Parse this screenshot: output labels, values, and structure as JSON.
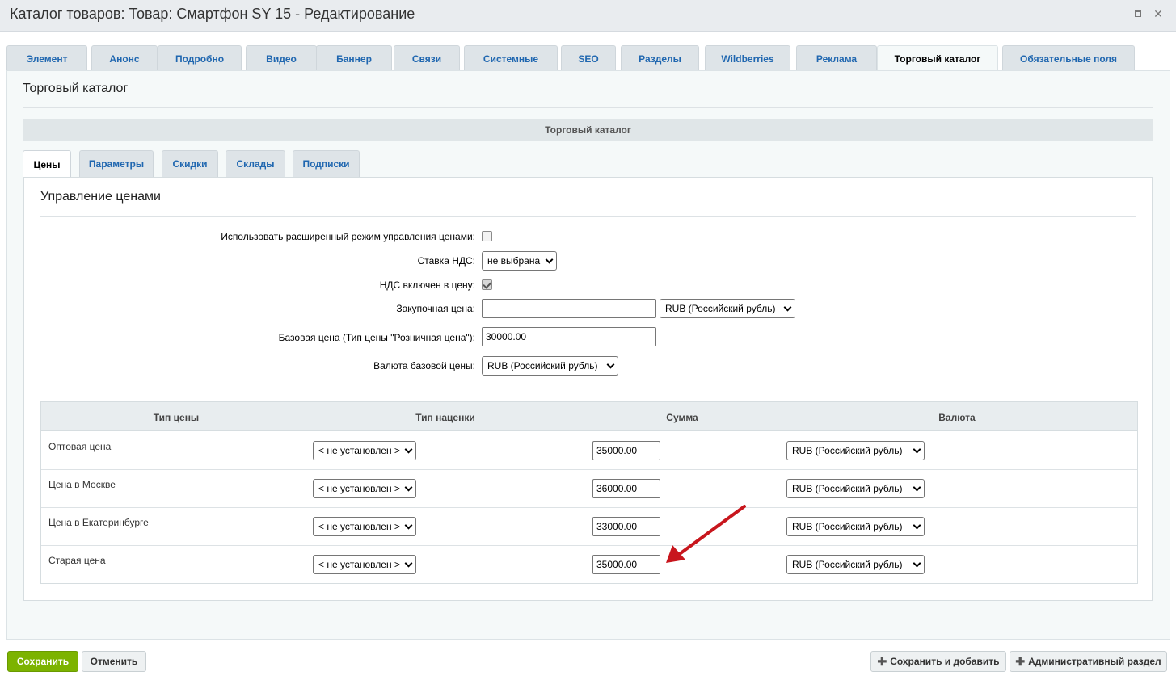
{
  "window": {
    "title": "Каталог товаров: Товар: Смартфон SY 15 - Редактирование",
    "maximize_icon": "maximize-icon",
    "close_icon": "close-icon"
  },
  "top_tabs": [
    {
      "label": "Элемент",
      "active": false
    },
    {
      "label": "Анонс",
      "active": false
    },
    {
      "label": "Подробно",
      "active": false
    },
    {
      "label": "Видео",
      "active": false
    },
    {
      "label": "Баннер",
      "active": false
    },
    {
      "label": "Связи",
      "active": false
    },
    {
      "label": "Системные",
      "active": false
    },
    {
      "label": "SEO",
      "active": false
    },
    {
      "label": "Разделы",
      "active": false
    },
    {
      "label": "Wildberries",
      "active": false
    },
    {
      "label": "Реклама",
      "active": false
    },
    {
      "label": "Торговый каталог",
      "active": true
    },
    {
      "label": "Обязательные поля",
      "active": false
    }
  ],
  "section": {
    "title": "Торговый каталог",
    "block_header": "Торговый каталог"
  },
  "sub_tabs": [
    {
      "label": "Цены",
      "active": true
    },
    {
      "label": "Параметры",
      "active": false
    },
    {
      "label": "Скидки",
      "active": false
    },
    {
      "label": "Склады",
      "active": false
    },
    {
      "label": "Подписки",
      "active": false
    }
  ],
  "prices": {
    "title": "Управление ценами",
    "extended_mode_label": "Использовать расширенный режим управления ценами:",
    "extended_mode_checked": false,
    "vat_rate_label": "Ставка НДС:",
    "vat_rate_value": "не выбрана",
    "vat_included_label": "НДС включен в цену:",
    "vat_included_checked": true,
    "purchase_price_label": "Закупочная цена:",
    "purchase_price_value": "",
    "purchase_currency_value": "RUB (Российский рубль)",
    "base_price_label": "Базовая цена (Тип цены \"Розничная цена\"):",
    "base_price_value": "30000.00",
    "base_currency_label": "Валюта базовой цены:",
    "base_currency_value": "RUB (Российский рубль)"
  },
  "price_table": {
    "headers": [
      "Тип цены",
      "Тип наценки",
      "Сумма",
      "Валюта"
    ],
    "rows": [
      {
        "name": "Оптовая цена",
        "markup": "< не установлен >",
        "amount": "35000.00",
        "currency": "RUB (Российский рубль)"
      },
      {
        "name": "Цена в Москве",
        "markup": "< не установлен >",
        "amount": "36000.00",
        "currency": "RUB (Российский рубль)"
      },
      {
        "name": "Цена в Екатеринбурге",
        "markup": "< не установлен >",
        "amount": "33000.00",
        "currency": "RUB (Российский рубль)"
      },
      {
        "name": "Старая цена",
        "markup": "< не установлен >",
        "amount": "35000.00",
        "currency": "RUB (Российский рубль)"
      }
    ]
  },
  "annotation": {
    "color": "#c8161d",
    "icon": "red-arrow-icon"
  },
  "footer": {
    "save_label": "Сохранить",
    "cancel_label": "Отменить",
    "save_add_label": "Сохранить и добавить",
    "admin_label": "Административный раздел",
    "plus_icon": "plus-icon",
    "save_color": "#7cb300"
  }
}
